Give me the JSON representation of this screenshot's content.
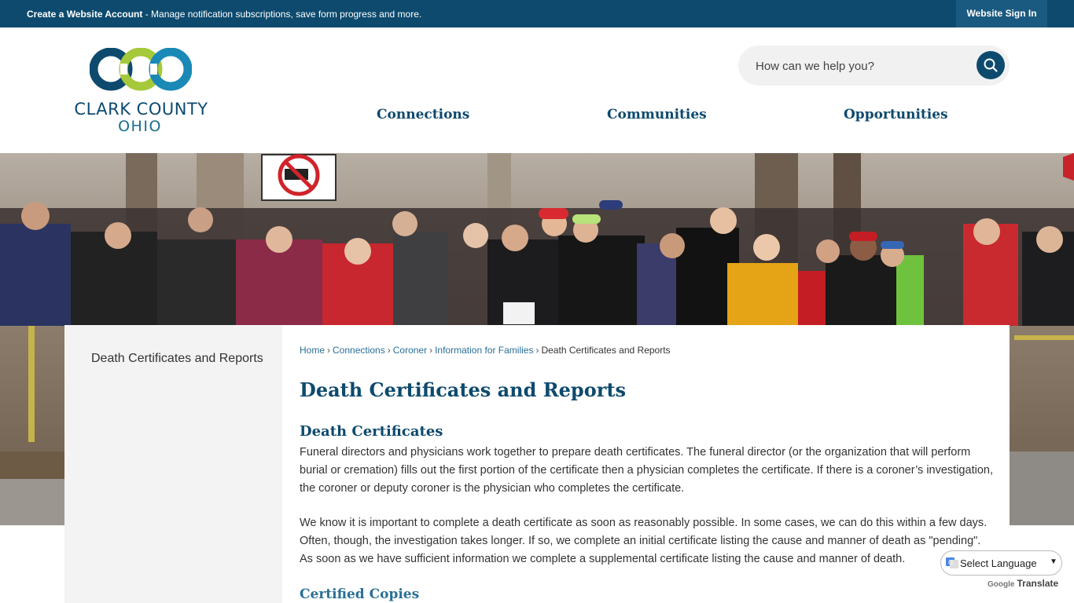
{
  "topbar": {
    "message_bold": "Create a Website Account",
    "message_rest": " - Manage notification subscriptions, save form progress and more.",
    "signin_label": "Website Sign In"
  },
  "logo": {
    "line1": "CLARK COUNTY",
    "line2": "OHIO",
    "colors": [
      "#0d4a6e",
      "#a5c93a",
      "#1a89b5"
    ]
  },
  "search": {
    "placeholder": "How can we help you?",
    "icon": "search-icon"
  },
  "nav": {
    "items": [
      "Connections",
      "Communities",
      "Opportunities"
    ]
  },
  "sidebar": {
    "items": [
      "Death Certificates and Reports"
    ]
  },
  "breadcrumb": {
    "items": [
      "Home",
      "Connections",
      "Coroner",
      "Information for Families"
    ],
    "current": "Death Certificates and Reports"
  },
  "main": {
    "title": "Death Certificates and Reports",
    "section1_heading": "Death Certificates",
    "para1": "Funeral directors and physicians work together to prepare death certificates. The funeral director (or the organization that will perform burial or cremation) fills out the first portion of the certificate then a physician completes the certificate. If there is a coroner’s investigation, the coroner or deputy coroner is the physician who completes the certificate.",
    "para2": "We know it is important to complete a death certificate as soon as reasonably possible. In some cases, we can do this within a few days. Often, though, the investigation takes longer. If so, we complete an initial certificate listing the cause and manner of death as \"pending\". As soon as we have sufficient information we complete a supplemental certificate listing the cause and manner of death.",
    "section2_heading": "Certified Copies"
  },
  "translate": {
    "select_label": "Select Language",
    "powered_by": "Google",
    "translate_label": "Translate"
  },
  "colors": {
    "brand_dark": "#0d4a6e",
    "link": "#2a6f97",
    "accent_green": "#a5c93a"
  }
}
